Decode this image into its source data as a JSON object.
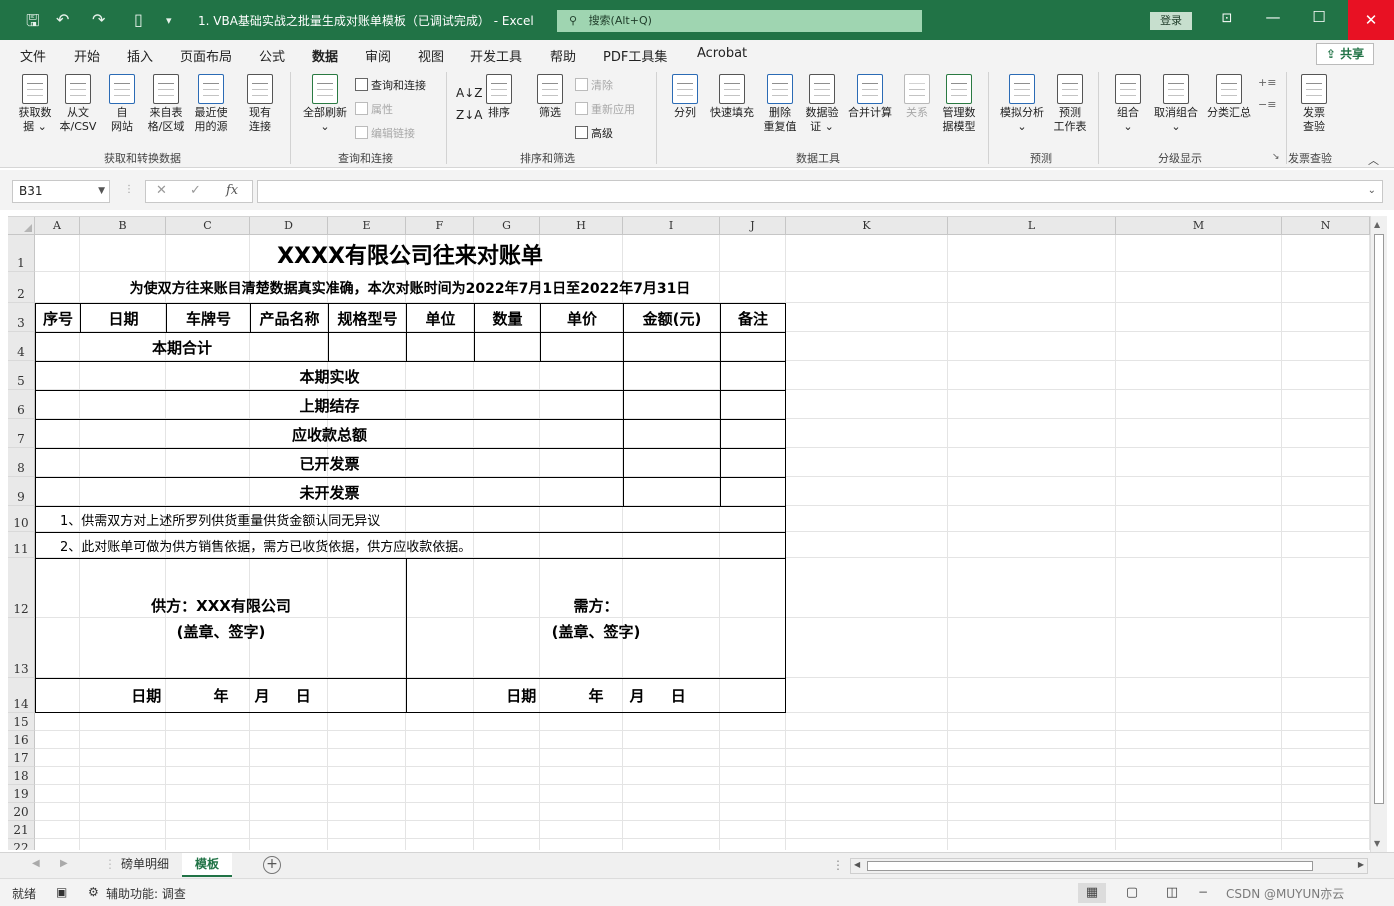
{
  "window": {
    "title": "1. VBA基础实战之批量生成对账单模板（已调试完成） - Excel",
    "search_placeholder": "搜索(Alt+Q)",
    "login": "登录",
    "share": "共享"
  },
  "menu_tabs": [
    "文件",
    "开始",
    "插入",
    "页面布局",
    "公式",
    "数据",
    "审阅",
    "视图",
    "开发工具",
    "帮助",
    "PDF工具集",
    "Acrobat"
  ],
  "active_tab": "数据",
  "ribbon": {
    "get_data": {
      "buttons": [
        {
          "line1": "获取数",
          "line2": "据 ⌄"
        },
        {
          "line1": "从文",
          "line2": "本/CSV"
        },
        {
          "line1": "自",
          "line2": "网站"
        },
        {
          "line1": "来自表",
          "line2": "格/区域"
        },
        {
          "line1": "最近使",
          "line2": "用的源"
        },
        {
          "line1": "现有",
          "line2": "连接"
        }
      ],
      "label": "获取和转换数据"
    },
    "queries": {
      "refresh": {
        "line1": "全部刷新",
        "line2": "⌄"
      },
      "items": [
        "查询和连接",
        "属性",
        "编辑链接"
      ],
      "label": "查询和连接"
    },
    "sort_filter": {
      "sort": "排序",
      "filter": "筛选",
      "items": [
        "清除",
        "重新应用",
        "高级"
      ],
      "label": "排序和筛选"
    },
    "data_tools": {
      "buttons": [
        {
          "line1": "分列",
          "line2": ""
        },
        {
          "line1": "快速填充",
          "line2": ""
        },
        {
          "line1": "删除",
          "line2": "重复值"
        },
        {
          "line1": "数据验",
          "line2": "证 ⌄"
        },
        {
          "line1": "合并计算",
          "line2": ""
        },
        {
          "line1": "关系",
          "line2": ""
        },
        {
          "line1": "管理数",
          "line2": "据模型"
        }
      ],
      "label": "数据工具"
    },
    "forecast": {
      "buttons": [
        {
          "line1": "模拟分析",
          "line2": "⌄"
        },
        {
          "line1": "预测",
          "line2": "工作表"
        }
      ],
      "label": "预测"
    },
    "outline": {
      "buttons": [
        {
          "line1": "组合",
          "line2": "⌄"
        },
        {
          "line1": "取消组合",
          "line2": "⌄"
        },
        {
          "line1": "分类汇总",
          "line2": ""
        }
      ],
      "label": "分级显示"
    },
    "invoice": {
      "button": {
        "line1": "发票",
        "line2": "查验"
      },
      "label": "发票查验"
    }
  },
  "formula_bar": {
    "name_box": "B31",
    "fx": "fx",
    "formula": ""
  },
  "columns": [
    "A",
    "B",
    "C",
    "D",
    "E",
    "F",
    "G",
    "H",
    "I",
    "J",
    "K",
    "L",
    "M",
    "N"
  ],
  "rows": [
    "1",
    "2",
    "3",
    "4",
    "5",
    "6",
    "7",
    "8",
    "9",
    "10",
    "11",
    "12",
    "13",
    "14",
    "15",
    "16",
    "17",
    "18",
    "19",
    "20",
    "21",
    "22"
  ],
  "sheet": {
    "title": "XXXX有限公司往来对账单",
    "subtitle": "为使双方往来账目清楚数据真实准确，本次对账时间为2022年7月1日至2022年7月31日",
    "headers": [
      "序号",
      "日期",
      "车牌号",
      "产品名称",
      "规格型号",
      "单位",
      "数量",
      "单价",
      "金额(元)",
      "备注"
    ],
    "total_row": "本期合计",
    "summary_rows": [
      "本期实收",
      "上期结存",
      "应收款总额",
      "已开发票",
      "未开发票"
    ],
    "notes": [
      "1、供需双方对上述所罗列供货重量供货金额认同无异议",
      "2、此对账单可做为供方销售依据，需方已收货依据，供方应收款依据。"
    ],
    "supplier": {
      "line1": "供方：XXX有限公司",
      "line2": "(盖章、签字)"
    },
    "buyer": {
      "line1": "需方：",
      "line2": "(盖章、签字)"
    },
    "date_line": "日期          年     月     日"
  },
  "sheet_tabs": [
    "磅单明细",
    "模板"
  ],
  "active_sheet": "模板",
  "status": {
    "ready": "就绪",
    "accessibility": "辅助功能: 调查",
    "watermark": "CSDN @MUYUN亦云"
  }
}
